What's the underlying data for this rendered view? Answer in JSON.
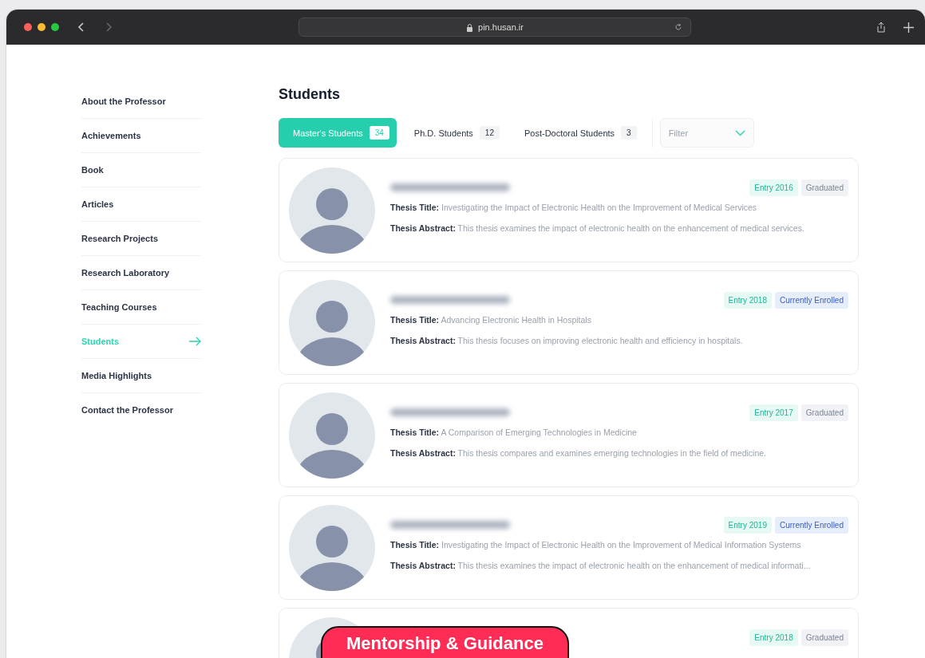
{
  "browser": {
    "url": "pin.husan.ir"
  },
  "sidebar": {
    "items": [
      {
        "label": "About the Professor",
        "selected": false
      },
      {
        "label": "Achievements",
        "selected": false
      },
      {
        "label": "Book",
        "selected": false
      },
      {
        "label": "Articles",
        "selected": false
      },
      {
        "label": "Research Projects",
        "selected": false
      },
      {
        "label": "Research Laboratory",
        "selected": false
      },
      {
        "label": "Teaching Courses",
        "selected": false
      },
      {
        "label": "Students",
        "selected": true
      },
      {
        "label": "Media Highlights",
        "selected": false
      },
      {
        "label": "Contact the Professor",
        "selected": false
      }
    ]
  },
  "title": "Students",
  "tabs": [
    {
      "label": "Master's Students",
      "count": "34",
      "selected": true
    },
    {
      "label": "Ph.D. Students",
      "count": "12",
      "selected": false
    },
    {
      "label": "Post-Doctoral Students",
      "count": "3",
      "selected": false
    }
  ],
  "filter": {
    "placeholder": "Filter"
  },
  "students": [
    {
      "entry": "Entry 2016",
      "status": "Graduated",
      "kind": "graduated",
      "thesis_title_label": "Thesis Title:",
      "thesis_title": "Investigating the Impact of Electronic Health on the Improvement of Medical Services",
      "abstract_label": "Thesis Abstract:",
      "abstract": "This thesis examines the impact of electronic health on the enhancement of medical services."
    },
    {
      "entry": "Entry 2018",
      "status": "Currently Enrolled",
      "kind": "enrolled",
      "thesis_title_label": "Thesis Title:",
      "thesis_title": "Advancing Electronic Health in Hospitals",
      "abstract_label": "Thesis Abstract:",
      "abstract": "This thesis focuses on improving electronic health and efficiency in hospitals."
    },
    {
      "entry": "Entry 2017",
      "status": "Graduated",
      "kind": "graduated",
      "thesis_title_label": "Thesis Title:",
      "thesis_title": "A Comparison of Emerging Technologies in Medicine",
      "abstract_label": "Thesis Abstract:",
      "abstract": "This thesis compares and examines emerging technologies in the field of medicine."
    },
    {
      "entry": "Entry 2019",
      "status": "Currently Enrolled",
      "kind": "enrolled",
      "thesis_title_label": "Thesis Title:",
      "thesis_title": "Investigating the Impact of Electronic Health on the Improvement of Medical Information Systems",
      "abstract_label": "Thesis Abstract:",
      "abstract": "This thesis examines the impact of electronic health on the enhancement of medical informati..."
    },
    {
      "entry": "Entry 2018",
      "status": "Graduated",
      "kind": "graduated"
    }
  ],
  "overlay_label": "Mentorship & Guidance"
}
